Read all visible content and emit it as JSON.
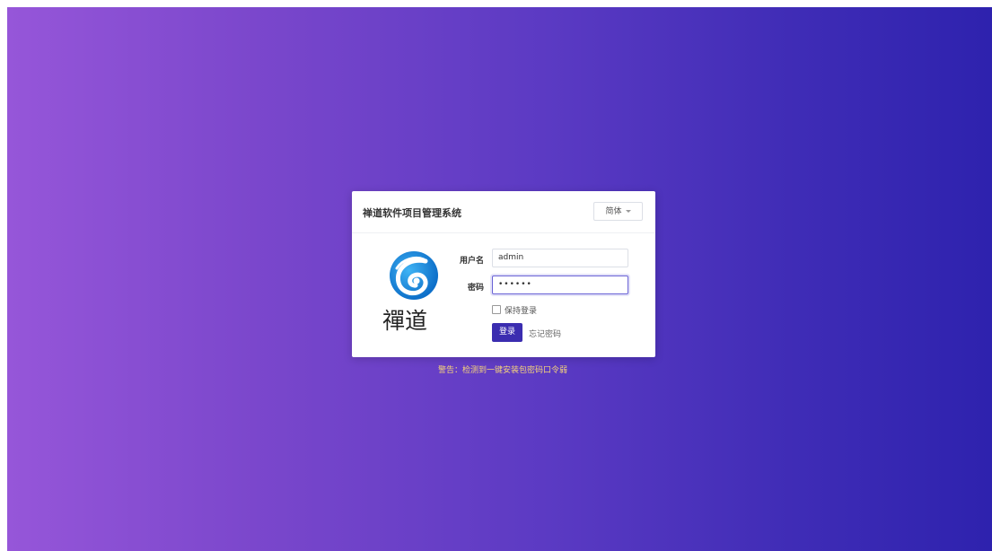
{
  "panel": {
    "title": "禅道软件项目管理系统",
    "language": "简体",
    "logo_text": "禪道"
  },
  "form": {
    "username_label": "用户名",
    "username_value": "admin",
    "password_label": "密码",
    "password_masked": "••••••",
    "remember_label": "保持登录",
    "remember_checked": false,
    "login_label": "登录",
    "forgot_label": "忘记密码"
  },
  "warning": "警告：检测到一键安装包密码口令弱",
  "colors": {
    "gradient_start": "#9656d9",
    "gradient_end": "#2e22ae",
    "primary": "#3b2db0",
    "logo_blue": "#1a8ee6",
    "warning": "#f5d37a"
  },
  "icons": {
    "logo": "zentao-swirl-icon",
    "dropdown": "caret-down-icon"
  }
}
